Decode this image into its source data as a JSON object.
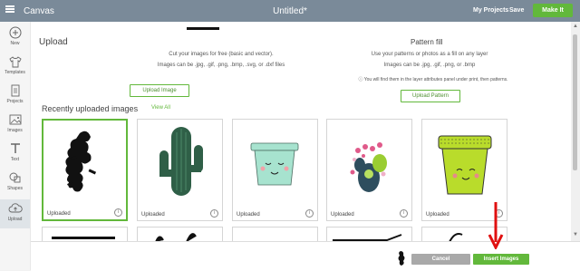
{
  "topbar": {
    "app_name": "Canvas",
    "document_title": "Untitled*",
    "my_projects": "My Projects",
    "save": "Save",
    "make_it": "Make It"
  },
  "sidebar": {
    "items": [
      {
        "label": "New",
        "icon": "plus-circle-icon"
      },
      {
        "label": "Templates",
        "icon": "shirt-icon"
      },
      {
        "label": "Projects",
        "icon": "document-icon"
      },
      {
        "label": "Images",
        "icon": "image-icon"
      },
      {
        "label": "Text",
        "icon": "text-icon"
      },
      {
        "label": "Shapes",
        "icon": "shapes-icon"
      },
      {
        "label": "Upload",
        "icon": "cloud-upload-icon"
      }
    ],
    "active": "Upload"
  },
  "upload": {
    "heading": "Upload",
    "line1": "Cut your images for free (basic and vector).",
    "line2": "Images can be .jpg, .gif, .png, .bmp, .svg, or .dxf files",
    "button": "Upload Image"
  },
  "pattern": {
    "heading": "Pattern fill",
    "line1": "Use your patterns or photos as a fill on any layer",
    "line2": "Images can be .jpg, .gif, .png, or .bmp",
    "note": "You will find them in the layer attributes panel under print, then patterns.",
    "button": "Upload Pattern"
  },
  "recent": {
    "heading": "Recently uploaded images",
    "view_all": "View All",
    "tiles": [
      {
        "label": "Uploaded",
        "selected": true,
        "image": "black-text-design"
      },
      {
        "label": "Uploaded",
        "selected": false,
        "image": "green-cactus"
      },
      {
        "label": "Uploaded",
        "selected": false,
        "image": "mint-pot-face"
      },
      {
        "label": "Uploaded",
        "selected": false,
        "image": "cactus-with-flowers"
      },
      {
        "label": "Uploaded",
        "selected": false,
        "image": "lime-pot-with-face"
      }
    ]
  },
  "footer": {
    "cancel": "Cancel",
    "insert": "Insert Images"
  },
  "colors": {
    "topbar": "#7a8a99",
    "accent_green": "#62b83b",
    "cancel_gray": "#a9a9a9",
    "arrow_red": "#e01010"
  }
}
